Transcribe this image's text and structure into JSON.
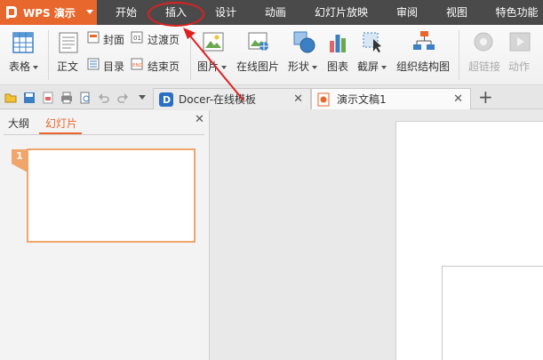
{
  "app": {
    "name": "WPS 演示"
  },
  "menu": {
    "items": [
      {
        "label": "开始"
      },
      {
        "label": "插入"
      },
      {
        "label": "设计"
      },
      {
        "label": "动画"
      },
      {
        "label": "幻灯片放映"
      },
      {
        "label": "审阅"
      },
      {
        "label": "视图"
      },
      {
        "label": "特色功能"
      }
    ],
    "active": "插入"
  },
  "ribbon": {
    "table": "表格",
    "body": "正文",
    "cover": "封面",
    "toc": "目录",
    "transition": "过渡页",
    "ending": "结束页",
    "picture": "图片",
    "online_picture": "在线图片",
    "shape": "形状",
    "chart": "图表",
    "screenshot": "截屏",
    "org_chart": "组织结构图",
    "hyperlink": "超链接",
    "action": "动作"
  },
  "tabs": [
    {
      "label": "Docer-在线模板"
    },
    {
      "label": "演示文稿1"
    }
  ],
  "left_panel": {
    "outline_tab": "大纲",
    "slides_tab": "幻灯片",
    "slide_number": "1"
  },
  "colors": {
    "accent": "#e8672c",
    "menubar": "#4a4a4a",
    "annotation": "#e02020"
  }
}
